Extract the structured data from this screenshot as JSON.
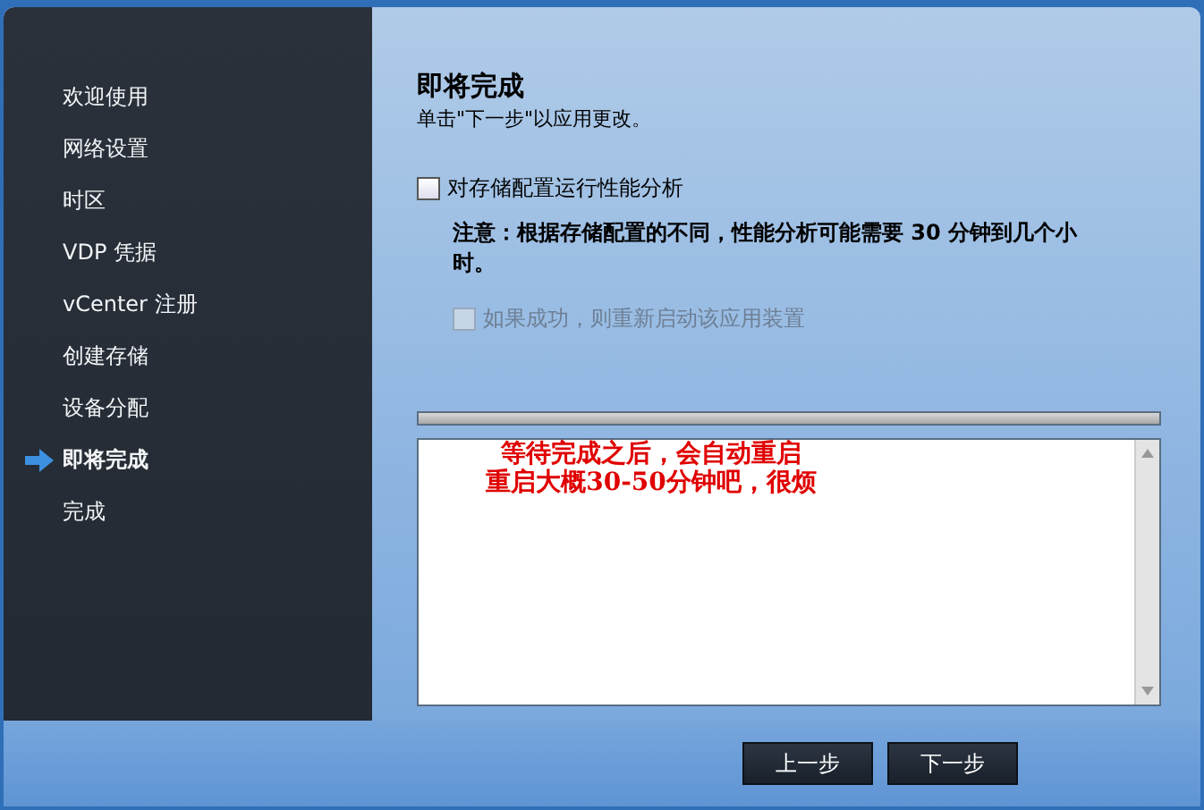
{
  "sidebar": {
    "items": [
      {
        "label": "欢迎使用",
        "selected": false
      },
      {
        "label": "网络设置",
        "selected": false
      },
      {
        "label": "时区",
        "selected": false
      },
      {
        "label": "VDP 凭据",
        "selected": false
      },
      {
        "label": "vCenter 注册",
        "selected": false
      },
      {
        "label": "创建存储",
        "selected": false
      },
      {
        "label": "设备分配",
        "selected": false
      },
      {
        "label": "即将完成",
        "selected": true
      },
      {
        "label": "完成",
        "selected": false
      }
    ]
  },
  "content": {
    "title": "即将完成",
    "subtitle": "单击\"下一步\"以应用更改。",
    "options": [
      {
        "kind": "checkbox",
        "label": "对存储配置运行性能分析",
        "checked": false,
        "disabled": false
      },
      {
        "kind": "note",
        "label": "注意：根据存储配置的不同，性能分析可能需要 30 分钟到几个小时。"
      },
      {
        "kind": "checkbox",
        "label": "如果成功，则重新启动该应用装置",
        "checked": false,
        "disabled": true
      }
    ],
    "progress": {
      "level": 0
    },
    "log": {
      "annotation": [
        "等待完成之后，会自动重启",
        "重启大概30-50分钟吧，很烦"
      ]
    }
  },
  "buttons": [
    {
      "label": "上一步"
    },
    {
      "label": "下一步"
    }
  ]
}
